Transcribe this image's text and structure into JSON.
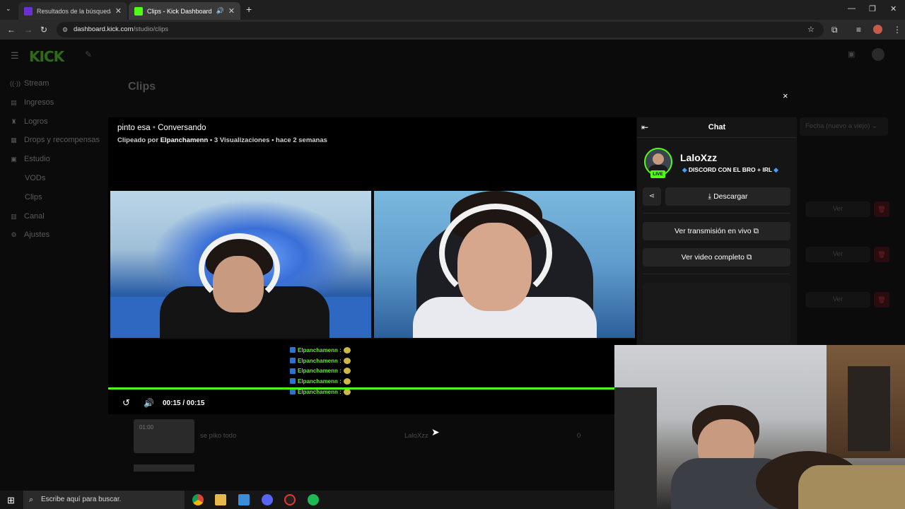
{
  "browser": {
    "tabs": [
      {
        "title": "Resultados de la búsqueda de in",
        "favicon_color": "#6b2fd4"
      },
      {
        "title": "Clips - Kick Dashboard",
        "favicon_color": "#53fc18"
      }
    ],
    "new_tab": "+",
    "url_host": "dashboard.kick.com",
    "url_path": "/studio/clips"
  },
  "dashboard": {
    "logo": "KICK",
    "sidebar": [
      {
        "icon": "stream-icon",
        "label": "Stream"
      },
      {
        "icon": "revenue-icon",
        "label": "Ingresos"
      },
      {
        "icon": "trophy-icon",
        "label": "Logros"
      },
      {
        "icon": "gift-icon",
        "label": "Drops y recompensas"
      },
      {
        "icon": "studio-icon",
        "label": "Estudio"
      },
      {
        "icon": "",
        "label": "VODs"
      },
      {
        "icon": "",
        "label": "Clips"
      },
      {
        "icon": "channel-icon",
        "label": "Canal"
      },
      {
        "icon": "gear-icon",
        "label": "Ajustes"
      }
    ],
    "page_title": "Clips",
    "sort": "Fecha (nuevo a viejo)",
    "view_label": "Ver",
    "row": {
      "duration": "01:00",
      "name": "se piko todo",
      "author": "LaloXzz",
      "views": "0"
    }
  },
  "modal": {
    "title": "pinto esa",
    "category": "Conversando",
    "meta_prefix": "Clipeado por",
    "clipper": "Elpanchamenn",
    "views": "3",
    "views_label": "Visualizaciones",
    "ago": "hace 2 semanas",
    "chat_user": "Elpanchamenn :",
    "time": "00:15 / 00:15",
    "progress": 1.0,
    "close": "×"
  },
  "chat": {
    "title": "Chat",
    "channel_name": "LaloXzz",
    "live_badge": "LIVE",
    "category": "DISCORD CON EL BRO + IRL",
    "download": "Descargar",
    "watch_live": "Ver transmisión en vivo",
    "watch_full": "Ver video completo"
  },
  "taskbar": {
    "search_placeholder": "Escribe aquí para buscar."
  },
  "colors": {
    "accent": "#53fc18",
    "danger": "#6a2027"
  }
}
